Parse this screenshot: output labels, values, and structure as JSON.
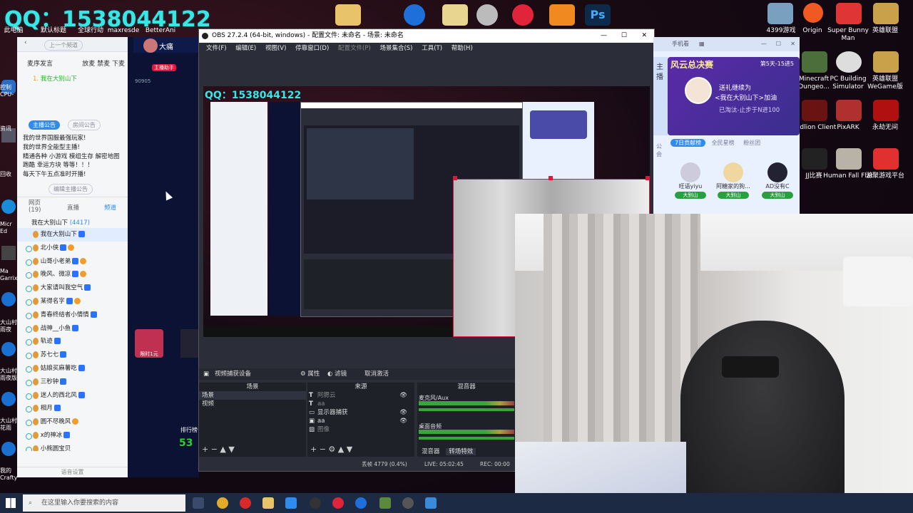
{
  "overlay": {
    "qq_text": "QQ：1538044122"
  },
  "desktop_left": [
    {
      "label": "此电脑"
    },
    {
      "label": "默认标题"
    },
    {
      "label": "全球行动"
    },
    {
      "label": "maxresde"
    },
    {
      "label": "BetterAni"
    }
  ],
  "desktop_left_side": [
    {
      "label": "控制"
    },
    {
      "label": "CPU-"
    },
    {
      "label": "资讯"
    },
    {
      "label": "回收"
    },
    {
      "label": "Micr Ed"
    },
    {
      "label": "Ma Garrix"
    },
    {
      "label": "大山村 雨夜"
    },
    {
      "label": "大山村 雨夜版"
    },
    {
      "label": "大山村 花雨"
    },
    {
      "label": "我的 Crafty"
    }
  ],
  "desktop_right": [
    {
      "label": "4399游戏"
    },
    {
      "label": "Origin"
    },
    {
      "label": "Super Bunny Man"
    },
    {
      "label": "英雄联盟"
    },
    {
      "label": "Minecraft Dungeo..."
    },
    {
      "label": "PC Building Simulator"
    },
    {
      "label": "英雄联盟 WeGame版"
    },
    {
      "label": "Badlion Client"
    },
    {
      "label": "PixARK"
    },
    {
      "label": "永劫无间"
    },
    {
      "label": "JJ比赛"
    },
    {
      "label": "Human Fall Flat"
    },
    {
      "label": "游聚游戏平台"
    }
  ],
  "chat": {
    "back_label": "上一个频道",
    "host_tag": "主播助手",
    "host_name": "大痛",
    "host_id": "90905",
    "toolbar_left": "麦序发言",
    "toolbar_right": "放麦 禁麦 下麦",
    "user_top": "我在大别山下",
    "tab_host_notice": "主播公告",
    "tab_room_notice": "房间公告",
    "notice_lines": [
      "我的世界国服最强玩家!",
      "我的世界全能型主播!",
      "精通各种 小游戏 模组生存 解密地图",
      "跑酷 幸运方块 等等！！！",
      "每天下午五点准时开播!"
    ],
    "edit_notice": "编辑主播公告",
    "tabs": [
      {
        "label": "网页 (19)"
      },
      {
        "label": "直播"
      },
      {
        "label": "频道"
      }
    ],
    "channel": "我在大别山下",
    "channel_count": "(4417)",
    "members": [
      "我在大别山下",
      "北小侠",
      "山哥小老弟",
      "晚风、微凉",
      "大家请叫我空气",
      "某得名字",
      "青春终结者小情情",
      "战神__小鱼",
      "轨迹",
      "苏七七",
      "姑娘买麻薯吃",
      "三秒钟",
      "迷人的西北风",
      "相月",
      "圆不尽晚风",
      "x的神冰",
      "小熊圆宝贝"
    ],
    "footer": "语音设置"
  },
  "mid": {
    "promo": "限时1元",
    "bottom_text": "排行榜",
    "score": "53"
  },
  "obs": {
    "title": "OBS 27.2.4 (64-bit, windows) - 配置文件: 未命名 - 场景: 未命名",
    "menus": [
      "文件(F)",
      "编辑(E)",
      "视图(V)",
      "停靠窗口(D)",
      "配置文件(P)",
      "场景集合(S)",
      "工具(T)",
      "帮助(H)"
    ],
    "toolbar": {
      "device": "视频捕获设备",
      "props": "属性",
      "filters": "滤镜",
      "deactivate": "取消激活"
    },
    "scenes_header": "场景",
    "scenes": [
      "场景",
      "视频"
    ],
    "sources_header": "来源",
    "sources": [
      "阿腮云",
      "aa",
      "显示器捕获",
      "aa",
      "图像"
    ],
    "mixer_header": "混音器",
    "mixer": [
      "麦克风/Aux",
      "桌面音频"
    ],
    "mixer_tabs": [
      "混音器",
      "转场特效"
    ],
    "status": {
      "dropped": "丢帧 4779 (0.4%)",
      "live": "LIVE: 05:02:45",
      "rec": "REC: 00:00"
    }
  },
  "rpanel": {
    "header": "手机看",
    "banner_title": "风云总决赛",
    "banner_sub": "第5天-15进5",
    "host_label": "主播",
    "gift_text": "送礼继续为",
    "gift_target": "<我在大别山下>加油",
    "gift_status": "已淘汰-止步于N进100",
    "side_label": "公会",
    "tabs": [
      "7日贡献榜",
      "全民星榜",
      "粉丝团"
    ],
    "fans": [
      {
        "name": "旺语yiyu",
        "tag": "大别山"
      },
      {
        "name": "阿糖家的狗...",
        "tag": "大别山"
      },
      {
        "name": "AD没有C",
        "tag": "大别山"
      }
    ]
  },
  "taskbar": {
    "search_placeholder": "在这里输入你要搜索的内容"
  },
  "colors": {
    "qq_cyan": "#39e6e6",
    "obs_bg": "#2b2e38",
    "selection_red": "#e0173d"
  }
}
